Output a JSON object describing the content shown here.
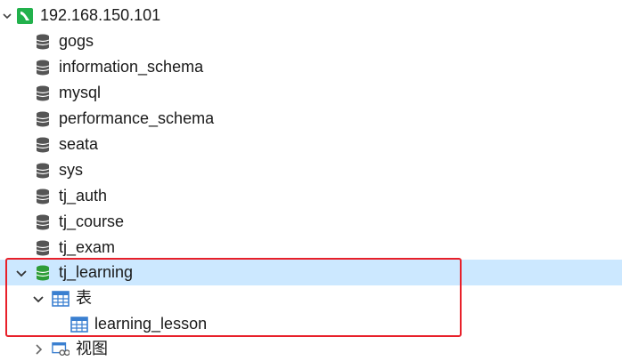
{
  "connection": {
    "label": "192.168.150.101",
    "expanded": true,
    "icon": "connection-icon",
    "icon_color": "#22b14c"
  },
  "databases": [
    {
      "label": "gogs"
    },
    {
      "label": "information_schema"
    },
    {
      "label": "mysql"
    },
    {
      "label": "performance_schema"
    },
    {
      "label": "seata"
    },
    {
      "label": "sys"
    },
    {
      "label": "tj_auth"
    },
    {
      "label": "tj_course"
    },
    {
      "label": "tj_exam"
    },
    {
      "label": "tj_learning"
    }
  ],
  "selected_database": {
    "label": "tj_learning",
    "expanded": true,
    "icon_color": "#2e9d38"
  },
  "tables_group": {
    "label": "表",
    "expanded": true
  },
  "tables": [
    {
      "label": "learning_lesson"
    }
  ],
  "views_group": {
    "label": "视图",
    "expanded": false
  },
  "colors": {
    "selection": "#cce8ff",
    "highlight_border": "#e8202a",
    "db_icon": "#555555",
    "table_icon": "#3a7fd0"
  }
}
